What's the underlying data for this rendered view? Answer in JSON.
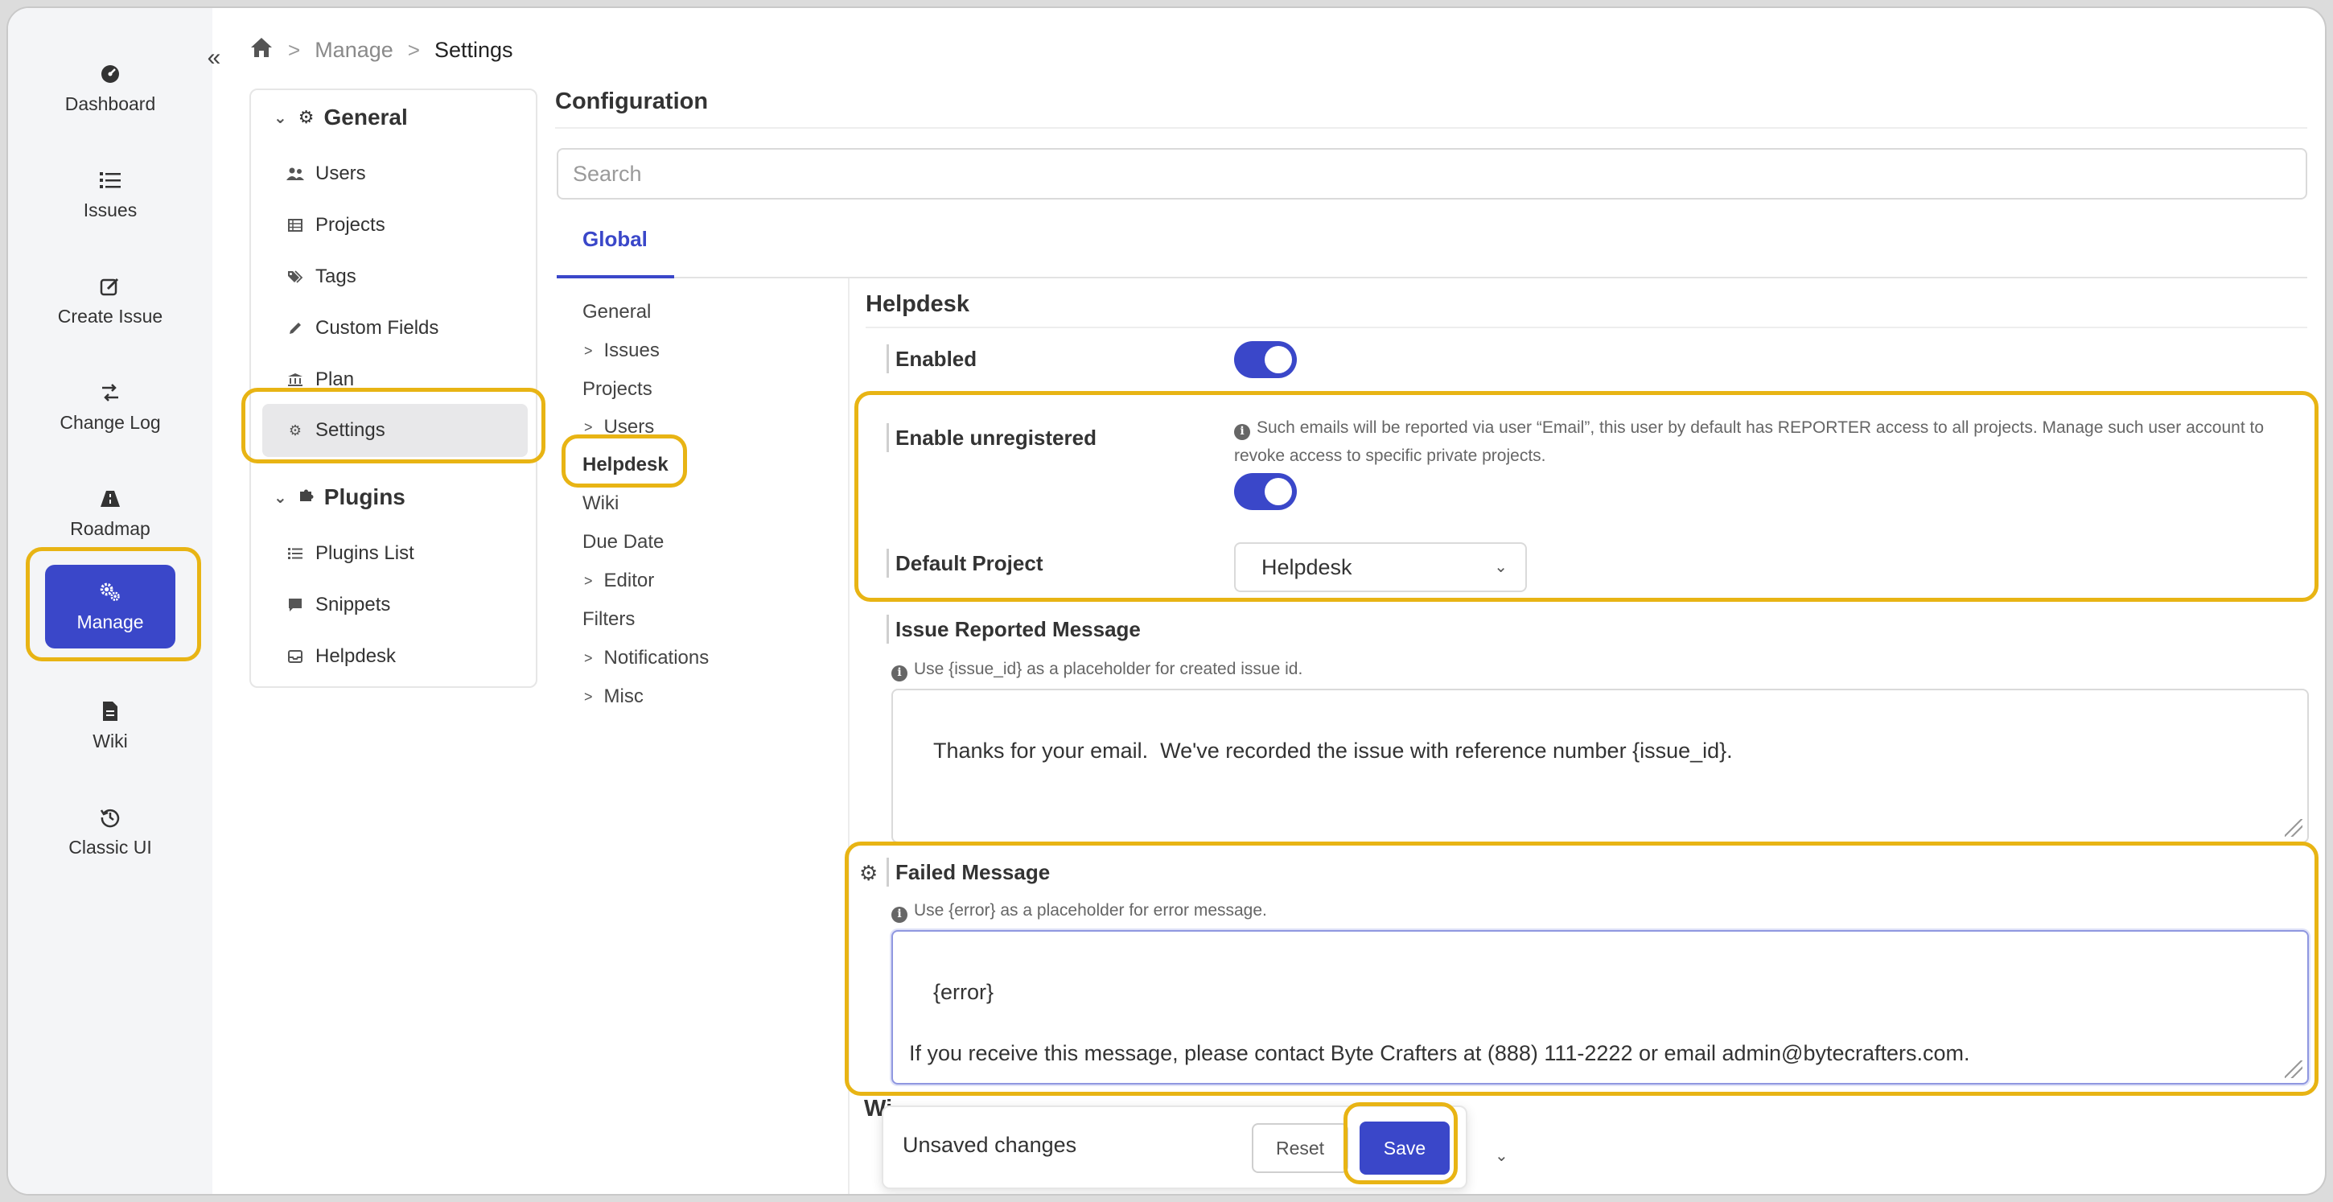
{
  "rail": {
    "items": [
      {
        "label": "Dashboard",
        "icon": "dashboard-icon"
      },
      {
        "label": "Issues",
        "icon": "list-icon"
      },
      {
        "label": "Create Issue",
        "icon": "edit-icon"
      },
      {
        "label": "Change Log",
        "icon": "changelog-icon"
      },
      {
        "label": "Roadmap",
        "icon": "roadmap-icon"
      },
      {
        "label": "Manage",
        "icon": "gears-icon"
      },
      {
        "label": "Wiki",
        "icon": "document-icon"
      },
      {
        "label": "Classic UI",
        "icon": "history-icon"
      }
    ],
    "active": "Manage",
    "collapse_glyph": "«"
  },
  "breadcrumb": {
    "home_icon": "home-icon",
    "manage": "Manage",
    "current": "Settings"
  },
  "nav": {
    "general_label": "General",
    "general_items": [
      {
        "label": "Users",
        "icon": "users-icon"
      },
      {
        "label": "Projects",
        "icon": "table-icon"
      },
      {
        "label": "Tags",
        "icon": "tags-icon"
      },
      {
        "label": "Custom Fields",
        "icon": "pencil-icon"
      },
      {
        "label": "Plan",
        "icon": "bank-icon"
      },
      {
        "label": "Settings",
        "icon": "gear-icon"
      }
    ],
    "plugins_label": "Plugins",
    "plugins_items": [
      {
        "label": "Plugins List",
        "icon": "list-icon"
      },
      {
        "label": "Snippets",
        "icon": "comment-icon"
      },
      {
        "label": "Helpdesk",
        "icon": "inbox-icon"
      }
    ]
  },
  "main": {
    "title": "Configuration",
    "search_placeholder": "Search",
    "tab": "Global",
    "sub_nav": [
      {
        "label": "General",
        "expandable": false
      },
      {
        "label": "Issues",
        "expandable": true
      },
      {
        "label": "Projects",
        "expandable": false
      },
      {
        "label": "Users",
        "expandable": true
      },
      {
        "label": "Helpdesk",
        "expandable": false,
        "selected": true
      },
      {
        "label": "Wiki",
        "expandable": false
      },
      {
        "label": "Due Date",
        "expandable": false
      },
      {
        "label": "Editor",
        "expandable": true
      },
      {
        "label": "Filters",
        "expandable": false
      },
      {
        "label": "Notifications",
        "expandable": true
      },
      {
        "label": "Misc",
        "expandable": true
      }
    ]
  },
  "helpdesk": {
    "heading": "Helpdesk",
    "enabled_label": "Enabled",
    "enabled": true,
    "unregistered_label": "Enable unregistered",
    "unregistered_help": "Such emails will be reported via user “Email”, this user by default has REPORTER access to all projects. Manage such user account to revoke access to specific private projects.",
    "unregistered": true,
    "default_project_label": "Default Project",
    "default_project_value": "Helpdesk",
    "issue_reported_label": "Issue Reported Message",
    "issue_reported_help": "Use {issue_id} as a placeholder for created issue id.",
    "issue_reported_value": "Thanks for your email.  We've recorded the issue with reference number {issue_id}.",
    "failed_label": "Failed Message",
    "failed_help": "Use {error} as a placeholder for error message.",
    "failed_value": "{error}\n\nIf you receive this message, please contact Byte Crafters at (888) 111-2222 or email admin@bytecrafters.com.",
    "next_heading_partial": "Wi"
  },
  "savebar": {
    "message": "Unsaved changes",
    "reset": "Reset",
    "save": "Save"
  },
  "colors": {
    "accent": "#3a47c9",
    "highlight": "#e8b414"
  }
}
